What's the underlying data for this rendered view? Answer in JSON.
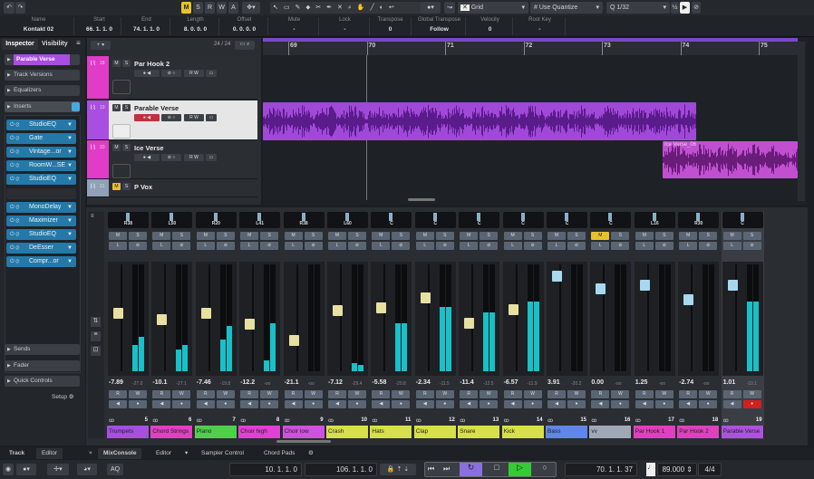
{
  "toolbar": {
    "mode_buttons": [
      "M",
      "S",
      "R",
      "W",
      "A"
    ],
    "snap_type": "Grid",
    "quantize_mode": "Use Quantize",
    "quantize_label": "Q",
    "quantize_value": "1/32"
  },
  "info_line": [
    {
      "label": "Name",
      "value": "Kontakt 02"
    },
    {
      "label": "Start",
      "value": "66. 1. 1.   0"
    },
    {
      "label": "End",
      "value": "74. 1. 1.   0"
    },
    {
      "label": "Length",
      "value": "8. 0. 0.   0"
    },
    {
      "label": "Offset",
      "value": "0. 0. 0.   0"
    },
    {
      "label": "Mute",
      "value": "-"
    },
    {
      "label": "Lock",
      "value": "-"
    },
    {
      "label": "Transpose",
      "value": "0"
    },
    {
      "label": "Global Transpose",
      "value": "Follow"
    },
    {
      "label": "Velocity",
      "value": "0"
    },
    {
      "label": "Root Key",
      "value": "-"
    }
  ],
  "inspector": {
    "tabs": [
      "Inspector",
      "Visibility"
    ],
    "track_name": "Parable Verse",
    "sections": [
      "Track Versions",
      "Equalizers",
      "Inserts"
    ],
    "inserts_a": [
      "StudioEQ",
      "Gate",
      "Vintage...or",
      "RoomW...SE",
      "StudioEQ"
    ],
    "inserts_b": [
      "MonoDelay",
      "Maximizer",
      "StudioEQ",
      "DeEsser",
      "Compr...or"
    ],
    "bottom_sections": [
      "Sends",
      "Fader",
      "Quick Controls"
    ],
    "setup": "Setup"
  },
  "project": {
    "track_count": "24 / 24",
    "tracks": [
      {
        "num": "18",
        "name": "Par Hook 2",
        "color": "#e03cc8"
      },
      {
        "num": "19",
        "name": "Parable Verse",
        "color": "#a94ee0",
        "selected": true
      },
      {
        "num": "20",
        "name": "Ice Verse",
        "color": "#e03cc8"
      },
      {
        "num": "21",
        "name": "P Vox",
        "color": "#8fa0b8"
      }
    ],
    "ruler": [
      "69",
      "70",
      "71",
      "72",
      "73",
      "74",
      "75"
    ],
    "events": [
      {
        "name": "",
        "track": "Parable Verse"
      },
      {
        "name": "Ice Verse_06",
        "track": "Ice Verse"
      }
    ]
  },
  "mixer": {
    "channels": [
      {
        "num": "5",
        "name": "Trumpets",
        "color": "#a64fe0",
        "pan": "R38",
        "db": "-7.89",
        "peak": "-27.0",
        "fader": 0.53,
        "meter": [
          0.25,
          0.32
        ]
      },
      {
        "num": "6",
        "name": "Chord Strings",
        "color": "#e040c8",
        "pan": "L50",
        "db": "-10.1",
        "peak": "-27.1",
        "fader": 0.46,
        "meter": [
          0.2,
          0.25
        ]
      },
      {
        "num": "7",
        "name": "Piano",
        "color": "#4fd04a",
        "pan": "R20",
        "db": "-7.46",
        "peak": "-19.8",
        "fader": 0.53,
        "meter": [
          0.3,
          0.42
        ]
      },
      {
        "num": "8",
        "name": "Choir high",
        "color": "#e040d8",
        "pan": "L41",
        "db": "-12.2",
        "peak": "-oo",
        "fader": 0.42,
        "meter": [
          0.1,
          0.45
        ]
      },
      {
        "num": "9",
        "name": "Choir low",
        "color": "#d050e0",
        "pan": "R38",
        "db": "-21.1",
        "peak": "-oo",
        "fader": 0.26,
        "meter": [
          0,
          0
        ]
      },
      {
        "num": "10",
        "name": "Crash",
        "color": "#d6e048",
        "pan": "L60",
        "db": "-7.12",
        "peak": "-29.4",
        "fader": 0.55,
        "meter": [
          0.08,
          0.06
        ]
      },
      {
        "num": "11",
        "name": "Hats",
        "color": "#d6e048",
        "pan": "C",
        "db": "-5.58",
        "peak": "-20.8",
        "fader": 0.58,
        "meter": [
          0.45,
          0.45
        ]
      },
      {
        "num": "12",
        "name": "Clap",
        "color": "#d6e048",
        "pan": "C",
        "db": "-2.34",
        "peak": "-11.5",
        "fader": 0.68,
        "meter": [
          0.6,
          0.6
        ]
      },
      {
        "num": "13",
        "name": "Snare",
        "color": "#d6e048",
        "pan": "C",
        "db": "-11.4",
        "peak": "-12.5",
        "fader": 0.43,
        "meter": [
          0.55,
          0.55
        ]
      },
      {
        "num": "14",
        "name": "Kick",
        "color": "#d6e048",
        "pan": "C",
        "db": "-6.57",
        "peak": "-11.9",
        "fader": 0.56,
        "meter": [
          0.65,
          0.65
        ]
      },
      {
        "num": "15",
        "name": "Bass",
        "color": "#5f86e8",
        "pan": "C",
        "db": "3.91",
        "peak": "-20.2",
        "fader": 0.89,
        "meter": [
          0,
          0
        ]
      },
      {
        "num": "16",
        "name": "vv",
        "color": "#a0a8b8",
        "pan": "C",
        "db": "0.00",
        "peak": "-oo",
        "fader": 0.77,
        "meter": [
          0,
          0
        ],
        "mute": true
      },
      {
        "num": "17",
        "name": "Par Hook 1",
        "color": "#e040c0",
        "pan": "L16",
        "db": "1.25",
        "peak": "-oo",
        "fader": 0.8,
        "meter": [
          0,
          0
        ]
      },
      {
        "num": "18",
        "name": "Par Hook 2",
        "color": "#e040c0",
        "pan": "R30",
        "db": "-2.74",
        "peak": "-oo",
        "fader": 0.66,
        "meter": [
          0,
          0
        ]
      },
      {
        "num": "19",
        "name": "Parable Verse",
        "color": "#b050e0",
        "pan": "C",
        "db": "1.01",
        "peak": "-10.1",
        "fader": 0.8,
        "meter": [
          0.65,
          0.65
        ],
        "selected": true,
        "rec": true
      }
    ],
    "btn_labels": {
      "m": "M",
      "s": "S",
      "r": "R",
      "w": "W"
    }
  },
  "bottom_tabs": {
    "left": [
      "Track",
      "Editor"
    ],
    "main": [
      "MixConsole",
      "Editor",
      "Sampler Control",
      "Chord Pads"
    ]
  },
  "transport": {
    "aq": "AQ",
    "left_locator": "10. 1. 1.   0",
    "right_locator": "106. 1. 1.   0",
    "position": "70. 1. 1. 37",
    "tempo": "89.000",
    "signature": "4/4"
  },
  "colors": {
    "accent_yellow": "#e8c22c",
    "cycle": "#8a6fe0",
    "play": "#33cc33",
    "record": "#d02020"
  }
}
